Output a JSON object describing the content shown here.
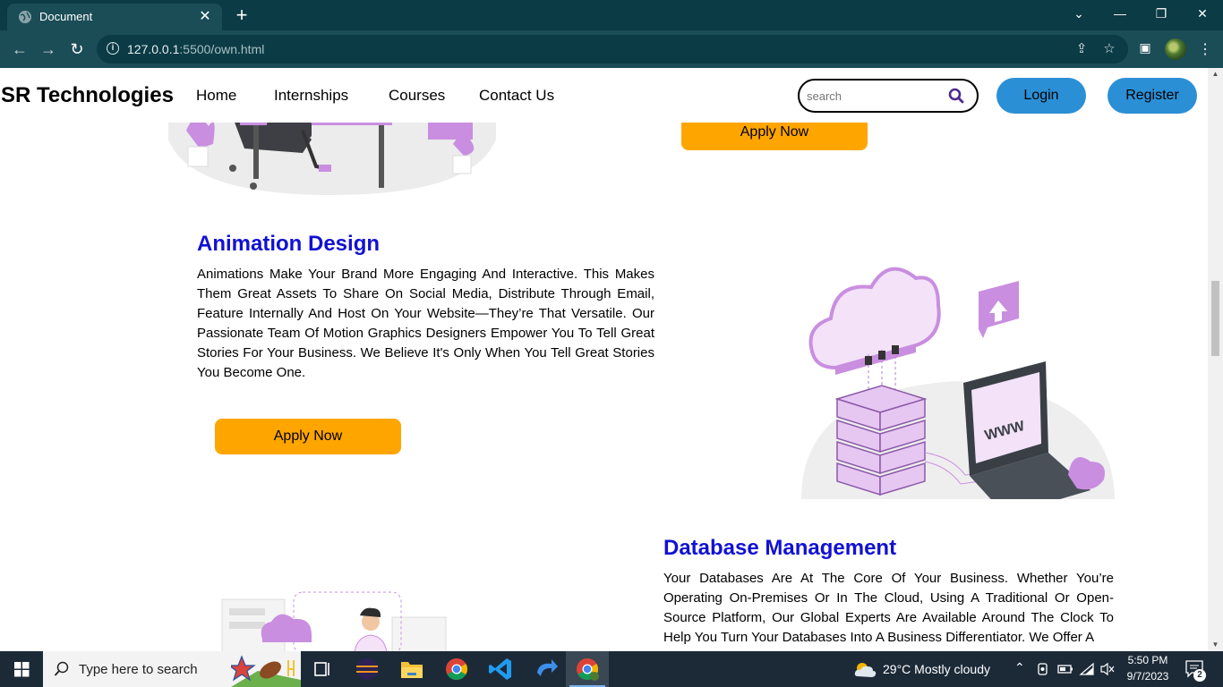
{
  "browser": {
    "tab_title": "Document",
    "new_tab": "+",
    "url_host": "127.0.0.1",
    "url_rest": ":5500/own.html"
  },
  "site": {
    "brand": "SR Technologies",
    "nav": [
      "Home",
      "Internships",
      "Courses",
      "Contact Us"
    ],
    "search_placeholder": "search",
    "login": "Login",
    "register": "Register"
  },
  "sections": {
    "top_apply": "Apply Now",
    "animation": {
      "title": "Animation Design",
      "text": "Animations Make Your Brand More Engaging And Interactive. This Makes Them Great Assets To Share On Social Media, Distribute Through Email, Feature Internally And Host On Your Website—They’re That Versatile. Our Passionate Team Of Motion Graphics Designers Empower You To Tell Great Stories For Your Business. We Believe It's Only When You Tell Great Stories You Become One.",
      "apply": "Apply Now"
    },
    "database": {
      "title": "Database Management",
      "text": "Your Databases Are At The Core Of Your Business. Whether You’re Operating On-Premises Or In The Cloud, Using A Traditional Or Open-Source Platform, Our Global Experts Are Available Around The Clock To Help You Turn Your Databases Into A Business Differentiator. We Offer A"
    },
    "illustration_label": "WWW"
  },
  "taskbar": {
    "search_text": "Type here to search",
    "weather": "29°C  Mostly cloudy",
    "time": "5:50 PM",
    "date": "9/7/2023",
    "notifications": "2"
  },
  "colors": {
    "accent_blue": "#2b8fd6",
    "apply_orange": "#ffa500",
    "title_blue": "#1111d4",
    "purple": "#c98ee0"
  }
}
